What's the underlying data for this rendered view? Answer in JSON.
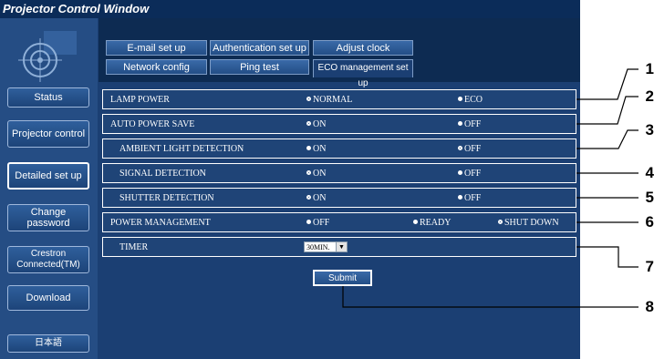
{
  "window": {
    "title": "Projector Control Window"
  },
  "sidebar": {
    "logo": "projector-logo-icon",
    "items": [
      {
        "label": "Status"
      },
      {
        "label": "Projector control"
      },
      {
        "label": "Detailed set up"
      },
      {
        "label": "Change password"
      },
      {
        "label": "Crestron Connected(TM)"
      },
      {
        "label": "Download"
      },
      {
        "label": "日本語"
      }
    ],
    "active": "Detailed set up"
  },
  "tabs": [
    {
      "label": "E-mail set up"
    },
    {
      "label": "Authentication set up"
    },
    {
      "label": "Adjust clock"
    },
    {
      "label": "Network config"
    },
    {
      "label": "Ping test"
    },
    {
      "label": "ECO management set up"
    }
  ],
  "active_tab": "ECO management set up",
  "settings": [
    {
      "label": "LAMP POWER",
      "options": [
        "NORMAL",
        "ECO"
      ],
      "selected": "NORMAL"
    },
    {
      "label": "AUTO POWER SAVE",
      "options": [
        "ON",
        "OFF"
      ],
      "selected": "ON"
    },
    {
      "label": "AMBIENT LIGHT DETECTION",
      "options": [
        "ON",
        "OFF"
      ],
      "selected": "OFF"
    },
    {
      "label": "SIGNAL DETECTION",
      "options": [
        "ON",
        "OFF"
      ],
      "selected": "ON"
    },
    {
      "label": "SHUTTER DETECTION",
      "options": [
        "ON",
        "OFF"
      ],
      "selected": "ON"
    },
    {
      "label": "POWER MANAGEMENT",
      "options": [
        "OFF",
        "READY",
        "SHUT DOWN"
      ],
      "selected": "SHUT DOWN"
    },
    {
      "label": "TIMER",
      "value": "30MIN."
    }
  ],
  "submit_label": "Submit",
  "callouts": [
    "1",
    "2",
    "3",
    "4",
    "5",
    "6",
    "7",
    "8"
  ],
  "colors": {
    "background": "#1b3f73",
    "titlebar": "#0b2c59",
    "sidebar": "#254d84",
    "text": "#ffffff"
  }
}
